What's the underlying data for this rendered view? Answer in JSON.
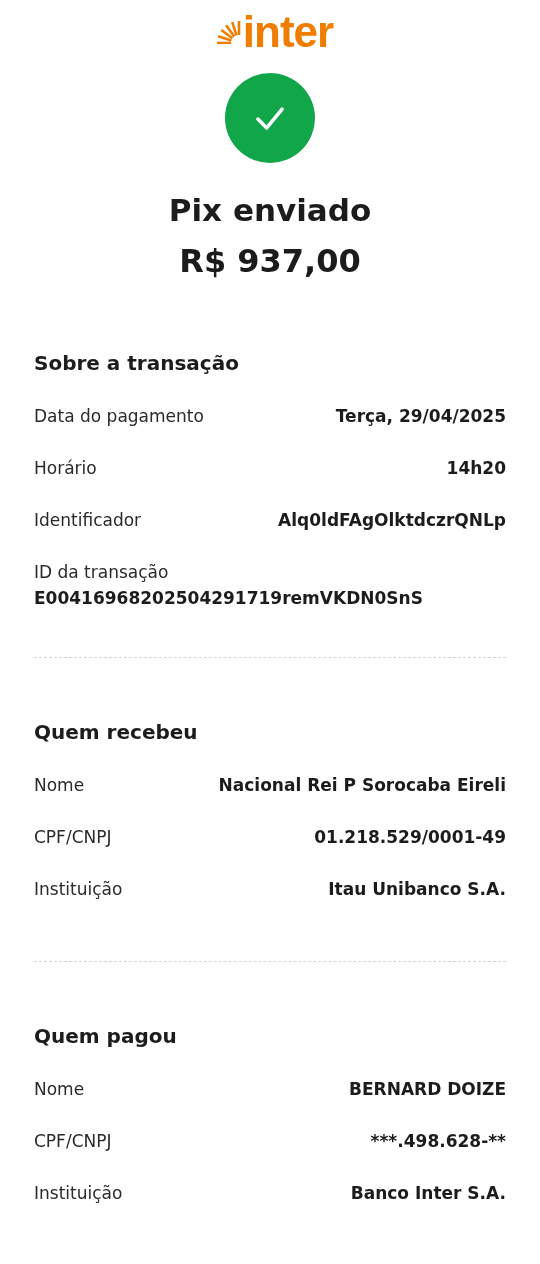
{
  "logo": {
    "text": "inter"
  },
  "status": {
    "kind": "success",
    "title": "Pix enviado",
    "amount": "R$ 937,00"
  },
  "sections": [
    {
      "title": "Sobre a transação",
      "rows": [
        {
          "kind": "inline",
          "label": "Data do pagamento",
          "value": "Terça, 29/04/2025"
        },
        {
          "kind": "inline",
          "label": "Horário",
          "value": "14h20"
        },
        {
          "kind": "inline",
          "label": "Identificador",
          "value": "Alq0ldFAgOlktdczrQNLp"
        },
        {
          "kind": "stacked",
          "label": "ID da transação",
          "value": "E00416968202504291719remVKDN0SnS"
        }
      ]
    },
    {
      "title": "Quem recebeu",
      "rows": [
        {
          "kind": "inline",
          "label": "Nome",
          "value": "Nacional Rei P Sorocaba Eireli"
        },
        {
          "kind": "inline",
          "label": "CPF/CNPJ",
          "value": "01.218.529/0001-49"
        },
        {
          "kind": "inline",
          "label": "Instituição",
          "value": "Itau Unibanco S.A."
        }
      ]
    },
    {
      "title": "Quem pagou",
      "rows": [
        {
          "kind": "inline",
          "label": "Nome",
          "value": "BERNARD DOIZE"
        },
        {
          "kind": "inline",
          "label": "CPF/CNPJ",
          "value": "***.498.628-**"
        },
        {
          "kind": "inline",
          "label": "Instituição",
          "value": "Banco Inter S.A."
        }
      ]
    }
  ]
}
